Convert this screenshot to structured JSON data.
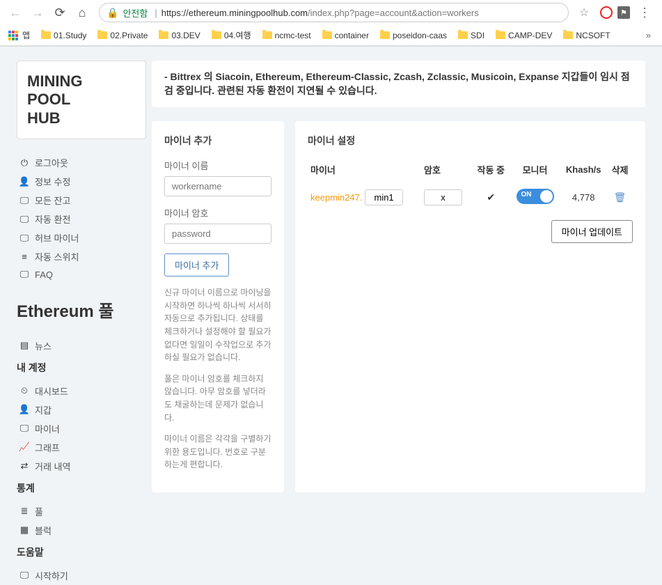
{
  "browser": {
    "secure_label": "안전함",
    "url_host": "https://ethereum.miningpoolhub.com",
    "url_path": "/index.php?page=account&action=workers"
  },
  "bookmarks": {
    "apps": "앱",
    "items": [
      "01.Study",
      "02.Private",
      "03.DEV",
      "04.여행",
      "ncmc-test",
      "container",
      "poseidon-caas",
      "SDI",
      "CAMP-DEV",
      "NCSOFT"
    ]
  },
  "logo": {
    "line1": "MINING",
    "line2": "POOL",
    "line3": "HUB"
  },
  "nav_main": [
    {
      "icon": "⏻",
      "label": "로그아웃"
    },
    {
      "icon": "👤",
      "label": "정보 수정"
    },
    {
      "icon": "🖵",
      "label": "모든 잔고"
    },
    {
      "icon": "🖵",
      "label": "자동 환전"
    },
    {
      "icon": "🖵",
      "label": "허브 마이너"
    },
    {
      "icon": "≡",
      "label": "자동 스위치"
    },
    {
      "icon": "🖵",
      "label": "FAQ"
    }
  ],
  "pool_heading": "Ethereum 풀",
  "news": {
    "label": "뉴스"
  },
  "account_heading": "내 계정",
  "account_items": [
    {
      "icon": "⏲",
      "label": "대시보드"
    },
    {
      "icon": "👤",
      "label": "지갑"
    },
    {
      "icon": "🖵",
      "label": "마이너"
    },
    {
      "icon": "📈",
      "label": "그래프"
    },
    {
      "icon": "⇄",
      "label": "거래 내역"
    }
  ],
  "stats_heading": "통계",
  "stats_items": [
    {
      "icon": "≣",
      "label": "풀"
    },
    {
      "icon": "▦",
      "label": "블럭"
    }
  ],
  "help_heading": "도움말",
  "help_items": [
    {
      "icon": "🖵",
      "label": "시작하기"
    }
  ],
  "alert": "- Bittrex 의 Siacoin, Ethereum, Ethereum-Classic, Zcash, Zclassic, Musicoin, Expanse 지갑들이 임시 점검 중입니다. 관련된 자동 환전이 지연될 수 있습니다.",
  "add_panel": {
    "title": "마이너 추가",
    "name_label": "마이너 이름",
    "name_placeholder": "workername",
    "pwd_label": "마이너 암호",
    "pwd_placeholder": "password",
    "button": "마이너 추가",
    "help1": "신규 마이너 이름으로 마이닝을 시작하면 하나씩 하나씩 서서히 자동으로 추가됩니다. 상태를 체크하거나 설정해야 할 필요가 없다면 일일이 수작업으로 추가하실 필요가 없습니다.",
    "help2": "풀은 마이너 암호를 체크하지 않습니다. 아무 암호를 넣더라도 채굴하는데 문제가 없습니다.",
    "help3": "마이너 이름은 각각을 구별하기 위한 용도입니다. 번호로 구분하는게 편합니다."
  },
  "settings_panel": {
    "title": "마이너 설정",
    "cols": {
      "miner": "마이너",
      "password": "암호",
      "active": "작동 중",
      "monitor": "모니터",
      "khash": "Khash/s",
      "delete": "삭제"
    },
    "rows": [
      {
        "user": "keepmin247.",
        "worker": "min1",
        "password": "x",
        "active": true,
        "monitor": "ON",
        "khash": "4,778"
      }
    ],
    "update_button": "마이너 업데이트"
  }
}
